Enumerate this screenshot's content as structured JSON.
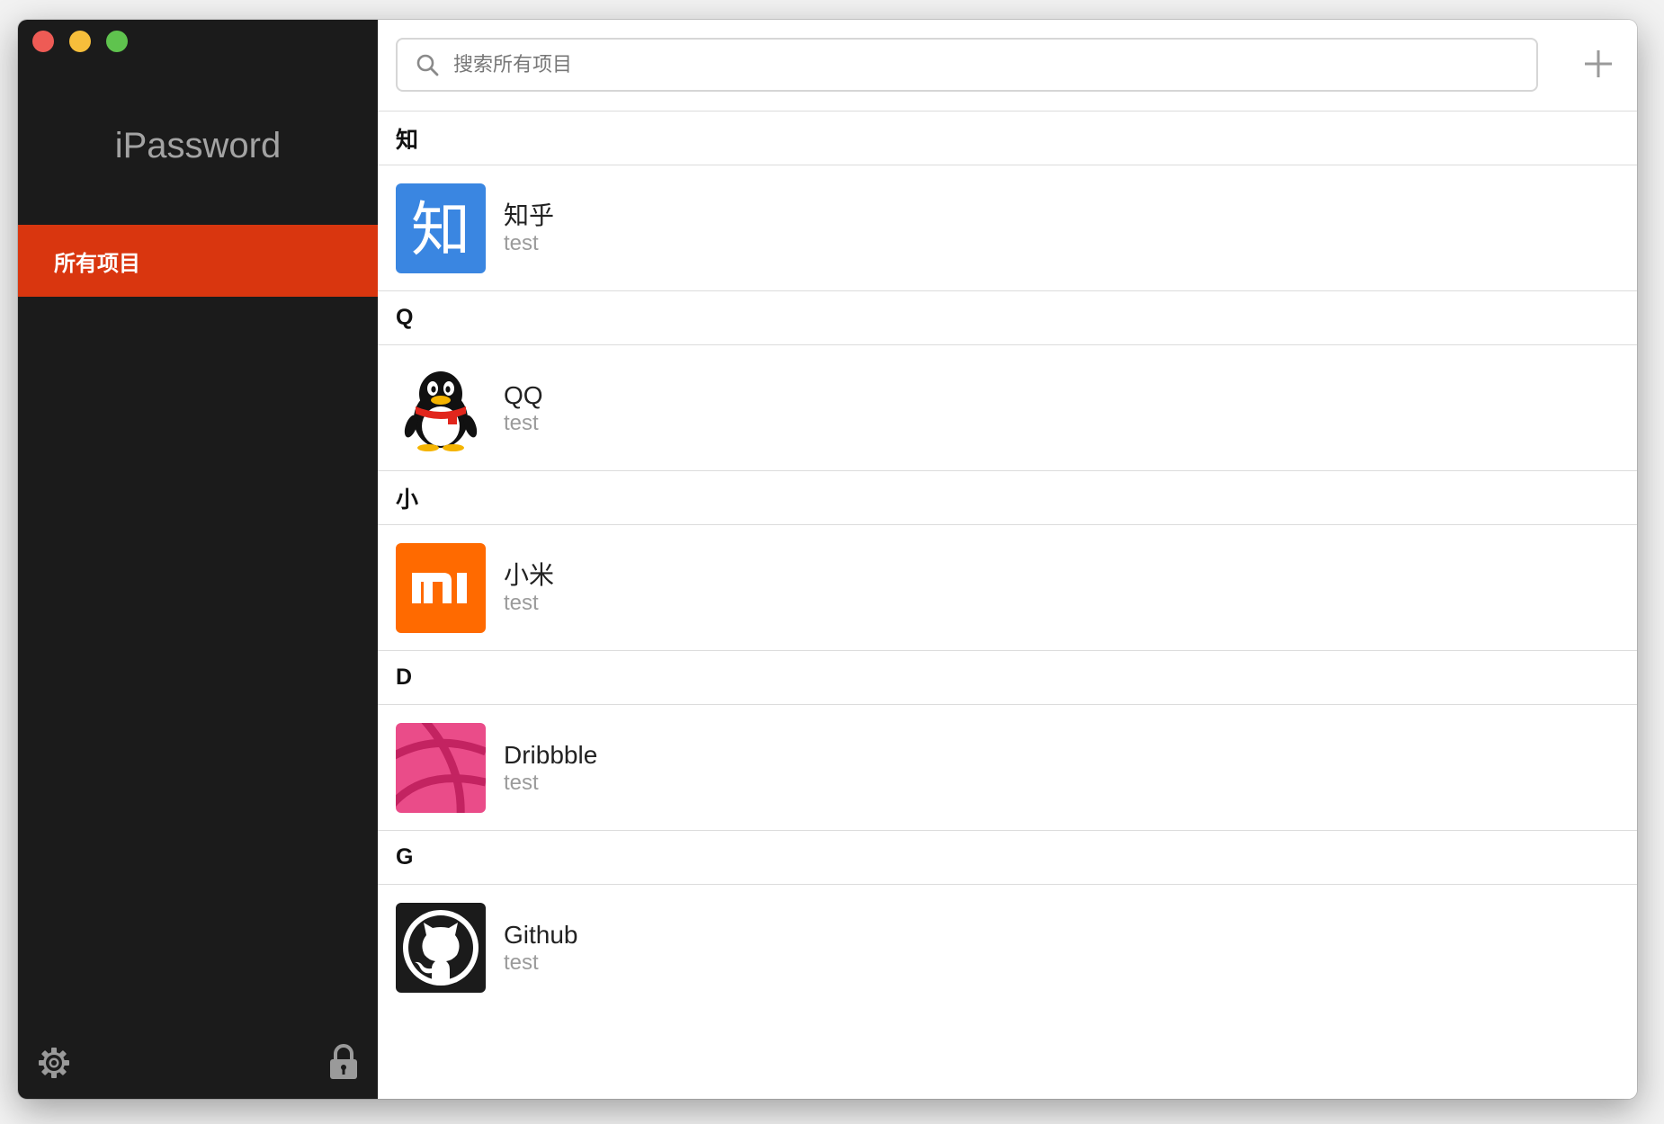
{
  "window": {
    "controls": {
      "close_color": "#ee5b55",
      "minimize_color": "#f6be3b",
      "zoom_color": "#5fc34e"
    }
  },
  "sidebar": {
    "app_title": "iPassword",
    "nav_items": [
      {
        "label": "所有项目",
        "selected": true,
        "color": "#d9360f"
      }
    ],
    "footer": {
      "settings_icon": "gear-icon",
      "lock_icon": "lock-icon"
    }
  },
  "toolbar": {
    "search": {
      "placeholder": "搜索所有项目",
      "value": "",
      "icon": "search-icon"
    },
    "add_icon": "plus-icon"
  },
  "sections": [
    {
      "header": "知",
      "items": [
        {
          "name": "知乎",
          "subtitle": "test",
          "icon": "zhihu-logo-icon",
          "color": "#3a86e1"
        }
      ]
    },
    {
      "header": "Q",
      "items": [
        {
          "name": "QQ",
          "subtitle": "test",
          "icon": "qq-penguin-icon",
          "color": "#ffffff"
        }
      ]
    },
    {
      "header": "小",
      "items": [
        {
          "name": "小米",
          "subtitle": "test",
          "icon": "xiaomi-logo-icon",
          "color": "#ff6a00"
        }
      ]
    },
    {
      "header": "D",
      "items": [
        {
          "name": "Dribbble",
          "subtitle": "test",
          "icon": "dribbble-logo-icon",
          "color": "#ea4c89"
        }
      ]
    },
    {
      "header": "G",
      "items": [
        {
          "name": "Github",
          "subtitle": "test",
          "icon": "github-logo-icon",
          "color": "#1b1b1b"
        }
      ]
    }
  ]
}
